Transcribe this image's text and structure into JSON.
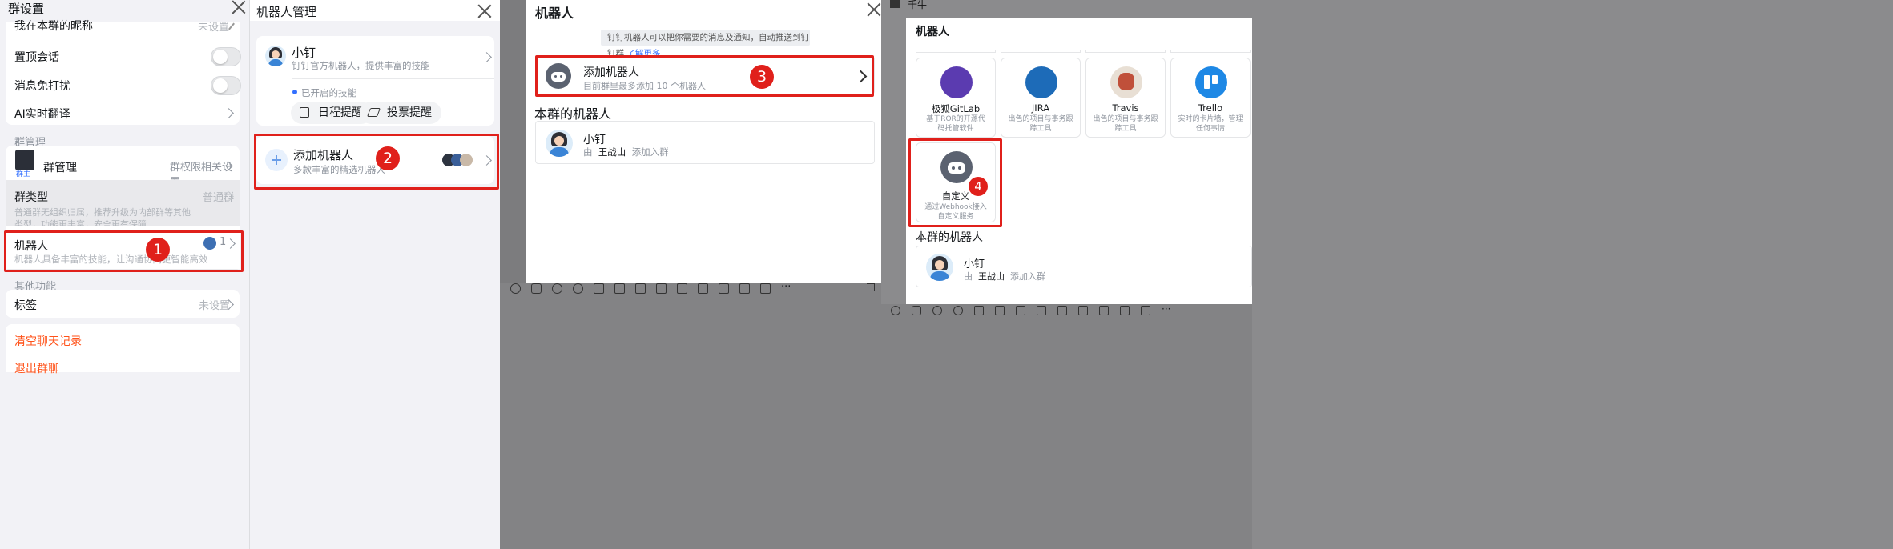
{
  "group_settings": {
    "title": "群设置",
    "nickname_label": "我在本群的昵称",
    "nickname_value": "未设置",
    "pin_label": "置顶会话",
    "mute_label": "消息免打扰",
    "translate_label": "AI实时翻译",
    "manage_section": "群管理",
    "manage_label": "群管理",
    "owner_badge": "群主",
    "manage_value": "群权限相关设置",
    "type_label": "群类型",
    "type_value": "普通群",
    "type_desc": "普通群无组织归属，推荐升级为内部群等其他类型，功能更丰富，安全更有保障",
    "robot_label": "机器人",
    "robot_desc": "机器人具备丰富的技能，让沟通协同更智能高效",
    "robot_count": "1",
    "other_section": "其他功能",
    "tag_label": "标签",
    "tag_value": "未设置",
    "clear_history": "清空聊天记录",
    "quit_group": "退出群聊"
  },
  "robot_manage": {
    "title": "机器人管理",
    "bot_name": "小钉",
    "bot_desc": "钉钉官方机器人，提供丰富的技能",
    "enabled_skills": "已开启的技能",
    "skills": [
      "日程提醒",
      "投票提醒"
    ],
    "add_title": "添加机器人",
    "add_desc": "多款丰富的精选机器人"
  },
  "robot_dialog": {
    "title": "机器人",
    "notice": "钉钉机器人可以把你需要的消息及通知，自动推送到钉钉群",
    "notice_link": "了解更多",
    "add_title": "添加机器人",
    "add_desc": "目前群里最多添加 10 个机器人",
    "section": "本群的机器人",
    "bot_name": "小钉",
    "bot_by": "由",
    "bot_owner": "王战山",
    "bot_added": "添加入群"
  },
  "robot_market": {
    "chat_title": "千牛",
    "title": "机器人",
    "tiles": [
      {
        "name": "极狐GitLab",
        "desc": "基于ROR的开源代码托管软件",
        "color": "#5b3bb0",
        "icon": "gitlab-icon"
      },
      {
        "name": "JIRA",
        "desc": "出色的项目与事务跟踪工具",
        "color": "#1d6bb8",
        "icon": "jira-icon"
      },
      {
        "name": "Travis",
        "desc": "出色的项目与事务跟踪工具",
        "color": "#e8dfd4",
        "icon": "travis-icon"
      },
      {
        "name": "Trello",
        "desc": "实时的卡片墙，管理任何事情",
        "color": "#1e88e5",
        "icon": "trello-icon"
      }
    ],
    "custom_name": "自定义",
    "custom_desc": "通过Webhook接入自定义服务",
    "section": "本群的机器人",
    "bot_name": "小钉",
    "bot_by": "由",
    "bot_owner": "王战山",
    "bot_added": "添加入群"
  },
  "steps": [
    "1",
    "2",
    "3",
    "4"
  ],
  "colors": {
    "highlight": "#e0201b",
    "link": "#3370ff",
    "danger": "#ff5219"
  }
}
